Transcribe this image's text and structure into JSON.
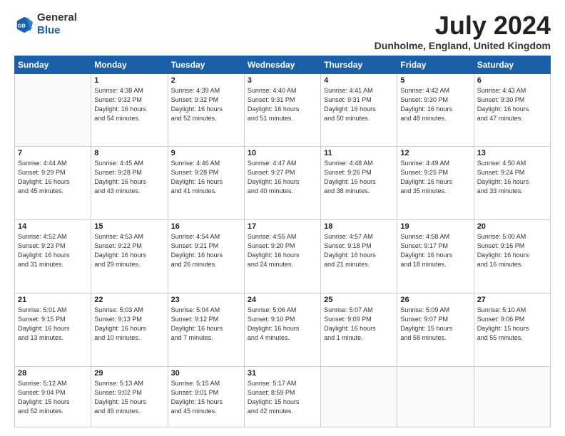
{
  "logo": {
    "general": "General",
    "blue": "Blue"
  },
  "title": "July 2024",
  "location": "Dunholme, England, United Kingdom",
  "days_of_week": [
    "Sunday",
    "Monday",
    "Tuesday",
    "Wednesday",
    "Thursday",
    "Friday",
    "Saturday"
  ],
  "weeks": [
    [
      {
        "day": "",
        "info": ""
      },
      {
        "day": "1",
        "info": "Sunrise: 4:38 AM\nSunset: 9:32 PM\nDaylight: 16 hours\nand 54 minutes."
      },
      {
        "day": "2",
        "info": "Sunrise: 4:39 AM\nSunset: 9:32 PM\nDaylight: 16 hours\nand 52 minutes."
      },
      {
        "day": "3",
        "info": "Sunrise: 4:40 AM\nSunset: 9:31 PM\nDaylight: 16 hours\nand 51 minutes."
      },
      {
        "day": "4",
        "info": "Sunrise: 4:41 AM\nSunset: 9:31 PM\nDaylight: 16 hours\nand 50 minutes."
      },
      {
        "day": "5",
        "info": "Sunrise: 4:42 AM\nSunset: 9:30 PM\nDaylight: 16 hours\nand 48 minutes."
      },
      {
        "day": "6",
        "info": "Sunrise: 4:43 AM\nSunset: 9:30 PM\nDaylight: 16 hours\nand 47 minutes."
      }
    ],
    [
      {
        "day": "7",
        "info": "Sunrise: 4:44 AM\nSunset: 9:29 PM\nDaylight: 16 hours\nand 45 minutes."
      },
      {
        "day": "8",
        "info": "Sunrise: 4:45 AM\nSunset: 9:28 PM\nDaylight: 16 hours\nand 43 minutes."
      },
      {
        "day": "9",
        "info": "Sunrise: 4:46 AM\nSunset: 9:28 PM\nDaylight: 16 hours\nand 41 minutes."
      },
      {
        "day": "10",
        "info": "Sunrise: 4:47 AM\nSunset: 9:27 PM\nDaylight: 16 hours\nand 40 minutes."
      },
      {
        "day": "11",
        "info": "Sunrise: 4:48 AM\nSunset: 9:26 PM\nDaylight: 16 hours\nand 38 minutes."
      },
      {
        "day": "12",
        "info": "Sunrise: 4:49 AM\nSunset: 9:25 PM\nDaylight: 16 hours\nand 35 minutes."
      },
      {
        "day": "13",
        "info": "Sunrise: 4:50 AM\nSunset: 9:24 PM\nDaylight: 16 hours\nand 33 minutes."
      }
    ],
    [
      {
        "day": "14",
        "info": "Sunrise: 4:52 AM\nSunset: 9:23 PM\nDaylight: 16 hours\nand 31 minutes."
      },
      {
        "day": "15",
        "info": "Sunrise: 4:53 AM\nSunset: 9:22 PM\nDaylight: 16 hours\nand 29 minutes."
      },
      {
        "day": "16",
        "info": "Sunrise: 4:54 AM\nSunset: 9:21 PM\nDaylight: 16 hours\nand 26 minutes."
      },
      {
        "day": "17",
        "info": "Sunrise: 4:55 AM\nSunset: 9:20 PM\nDaylight: 16 hours\nand 24 minutes."
      },
      {
        "day": "18",
        "info": "Sunrise: 4:57 AM\nSunset: 9:18 PM\nDaylight: 16 hours\nand 21 minutes."
      },
      {
        "day": "19",
        "info": "Sunrise: 4:58 AM\nSunset: 9:17 PM\nDaylight: 16 hours\nand 18 minutes."
      },
      {
        "day": "20",
        "info": "Sunrise: 5:00 AM\nSunset: 9:16 PM\nDaylight: 16 hours\nand 16 minutes."
      }
    ],
    [
      {
        "day": "21",
        "info": "Sunrise: 5:01 AM\nSunset: 9:15 PM\nDaylight: 16 hours\nand 13 minutes."
      },
      {
        "day": "22",
        "info": "Sunrise: 5:03 AM\nSunset: 9:13 PM\nDaylight: 16 hours\nand 10 minutes."
      },
      {
        "day": "23",
        "info": "Sunrise: 5:04 AM\nSunset: 9:12 PM\nDaylight: 16 hours\nand 7 minutes."
      },
      {
        "day": "24",
        "info": "Sunrise: 5:06 AM\nSunset: 9:10 PM\nDaylight: 16 hours\nand 4 minutes."
      },
      {
        "day": "25",
        "info": "Sunrise: 5:07 AM\nSunset: 9:09 PM\nDaylight: 16 hours\nand 1 minute."
      },
      {
        "day": "26",
        "info": "Sunrise: 5:09 AM\nSunset: 9:07 PM\nDaylight: 15 hours\nand 58 minutes."
      },
      {
        "day": "27",
        "info": "Sunrise: 5:10 AM\nSunset: 9:06 PM\nDaylight: 15 hours\nand 55 minutes."
      }
    ],
    [
      {
        "day": "28",
        "info": "Sunrise: 5:12 AM\nSunset: 9:04 PM\nDaylight: 15 hours\nand 52 minutes."
      },
      {
        "day": "29",
        "info": "Sunrise: 5:13 AM\nSunset: 9:02 PM\nDaylight: 15 hours\nand 49 minutes."
      },
      {
        "day": "30",
        "info": "Sunrise: 5:15 AM\nSunset: 9:01 PM\nDaylight: 15 hours\nand 45 minutes."
      },
      {
        "day": "31",
        "info": "Sunrise: 5:17 AM\nSunset: 8:59 PM\nDaylight: 15 hours\nand 42 minutes."
      },
      {
        "day": "",
        "info": ""
      },
      {
        "day": "",
        "info": ""
      },
      {
        "day": "",
        "info": ""
      }
    ]
  ]
}
